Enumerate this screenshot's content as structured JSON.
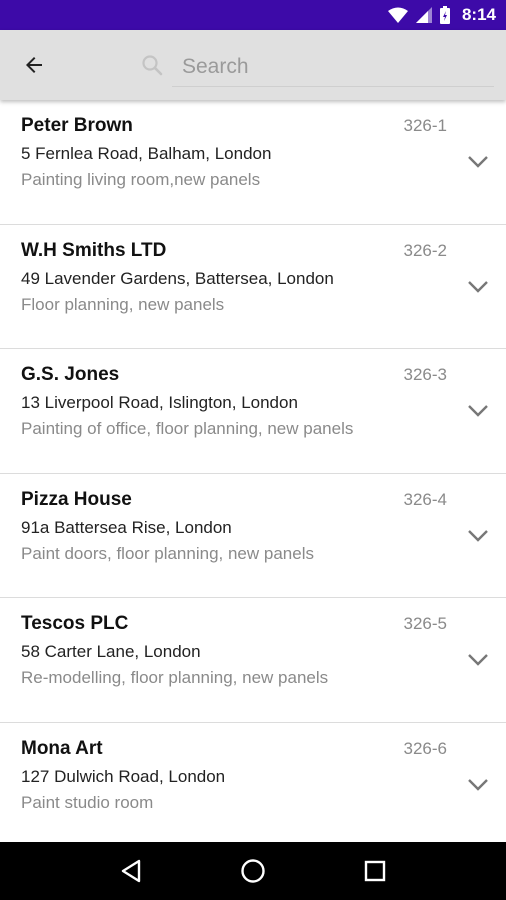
{
  "status_bar": {
    "time": "8:14",
    "icons": [
      "wifi-icon",
      "signal-icon",
      "battery-icon"
    ]
  },
  "app_bar": {
    "back_icon": "arrow-left-icon",
    "search_icon": "search-icon",
    "search_placeholder": "Search",
    "search_value": ""
  },
  "jobs": [
    {
      "name": "Peter Brown",
      "ref": "326-1",
      "address": "5 Fernlea Road, Balham, London",
      "description": "Painting living room,new panels"
    },
    {
      "name": "W.H Smiths LTD",
      "ref": "326-2",
      "address": "49 Lavender Gardens, Battersea, London",
      "description": "Floor planning, new panels"
    },
    {
      "name": "G.S. Jones",
      "ref": "326-3",
      "address": "13 Liverpool Road, Islington, London",
      "description": "Painting of office, floor planning, new panels"
    },
    {
      "name": "Pizza House",
      "ref": "326-4",
      "address": "91a Battersea Rise, London",
      "description": "Paint doors, floor planning, new panels"
    },
    {
      "name": "Tescos PLC",
      "ref": "326-5",
      "address": "58 Carter Lane, London",
      "description": "Re-modelling, floor planning, new panels"
    },
    {
      "name": "Mona Art",
      "ref": "326-6",
      "address": "127 Dulwich Road, London",
      "description": "Paint studio room"
    }
  ],
  "nav_bar": {
    "icons": [
      "back-triangle-icon",
      "home-circle-icon",
      "recents-square-icon"
    ]
  },
  "colors": {
    "status_bar": "#3d0aa8",
    "app_bar": "#e0e0e0",
    "secondary_text": "#8a8a8a"
  }
}
